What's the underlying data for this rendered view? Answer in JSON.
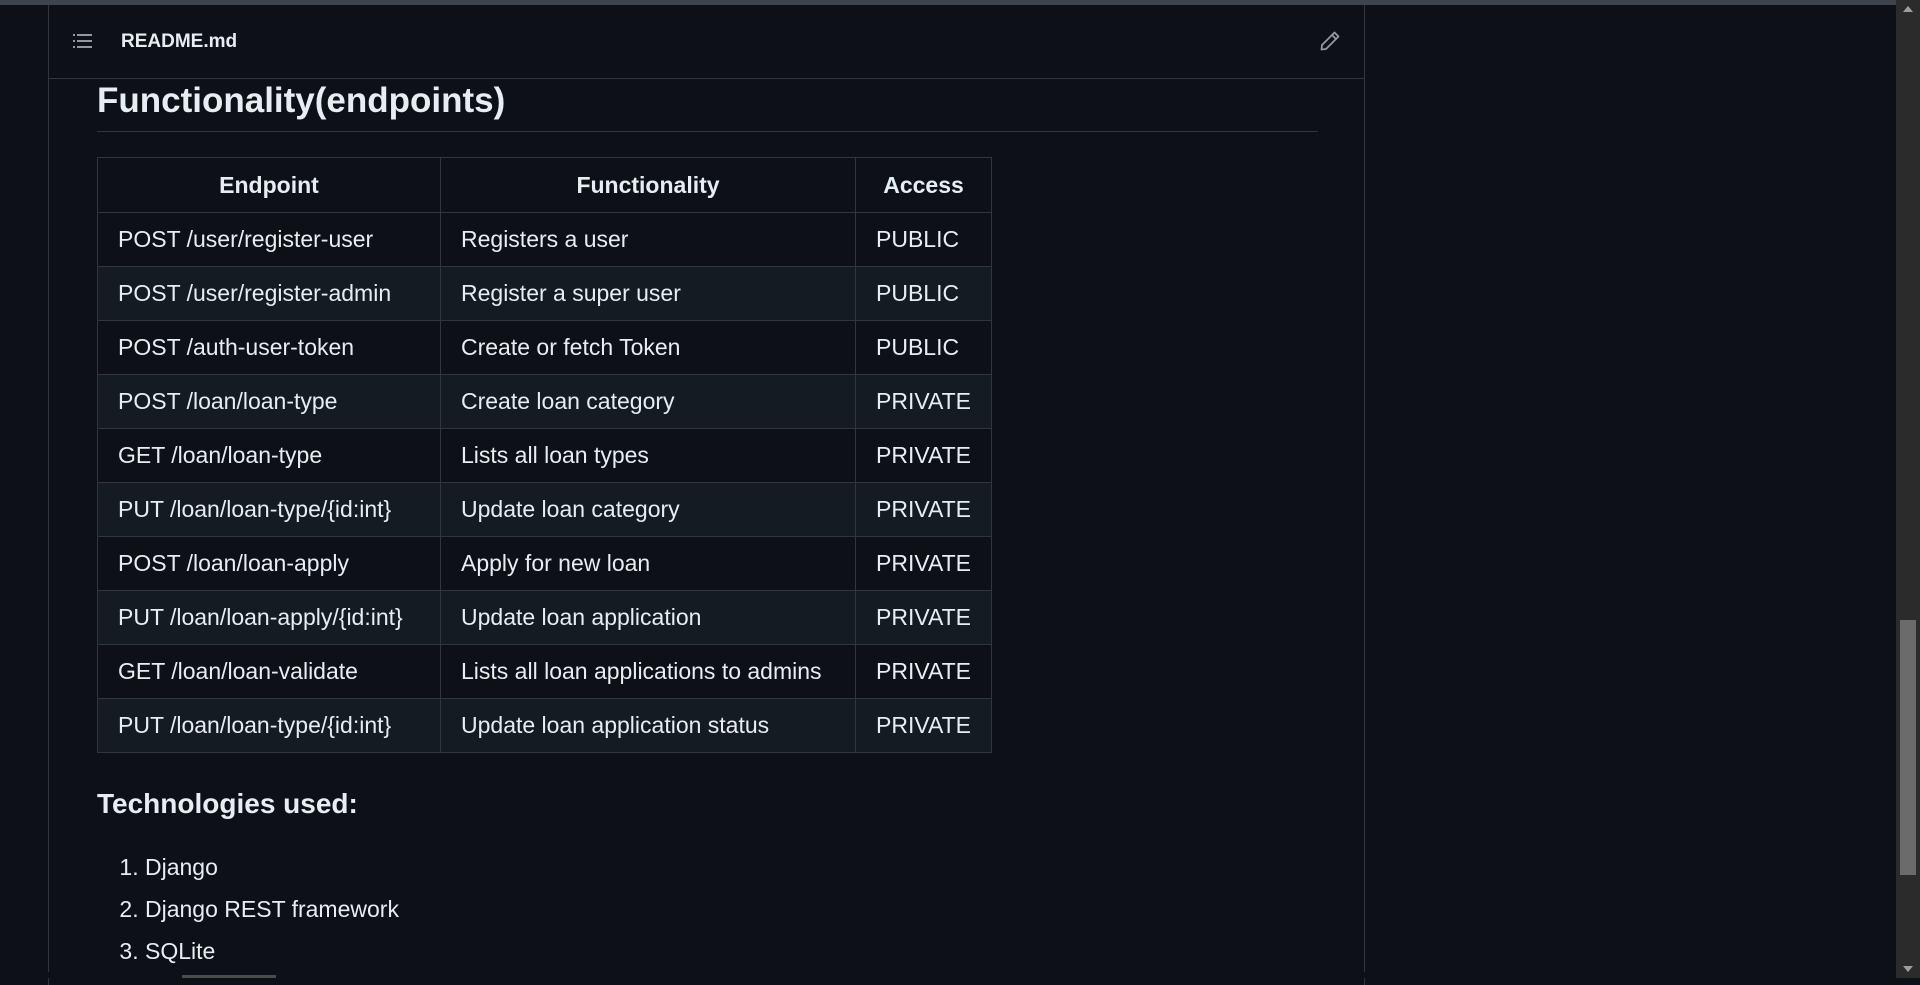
{
  "readme": {
    "filename": "README.md",
    "outline_icon": "list-unordered-icon",
    "edit_icon": "pencil-icon"
  },
  "section": {
    "title": "Functionality(endpoints)"
  },
  "table": {
    "headers": [
      "Endpoint",
      "Functionality",
      "Access"
    ],
    "rows": [
      [
        "POST /user/register-user",
        "Registers a user",
        "PUBLIC"
      ],
      [
        "POST /user/register-admin",
        "Register a super user",
        "PUBLIC"
      ],
      [
        "POST /auth-user-token",
        "Create or fetch Token",
        "PUBLIC"
      ],
      [
        "POST /loan/loan-type",
        "Create loan category",
        "PRIVATE"
      ],
      [
        "GET /loan/loan-type",
        "Lists all loan types",
        "PRIVATE"
      ],
      [
        "PUT /loan/loan-type/{id:int}",
        "Update loan category",
        "PRIVATE"
      ],
      [
        "POST /loan/loan-apply",
        "Apply for new loan",
        "PRIVATE"
      ],
      [
        "PUT /loan/loan-apply/{id:int}",
        "Update loan application",
        "PRIVATE"
      ],
      [
        "GET /loan/loan-validate",
        "Lists all loan applications to admins",
        "PRIVATE"
      ],
      [
        "PUT /loan/loan-type/{id:int}",
        "Update loan application status",
        "PRIVATE"
      ]
    ]
  },
  "technologies": {
    "title": "Technologies used:",
    "items": [
      "Django",
      "Django REST framework",
      "SQLite"
    ]
  },
  "colors": {
    "background": "#0d1117",
    "border": "#30363d",
    "text": "#e6edf3",
    "row_alt": "#151b23"
  }
}
